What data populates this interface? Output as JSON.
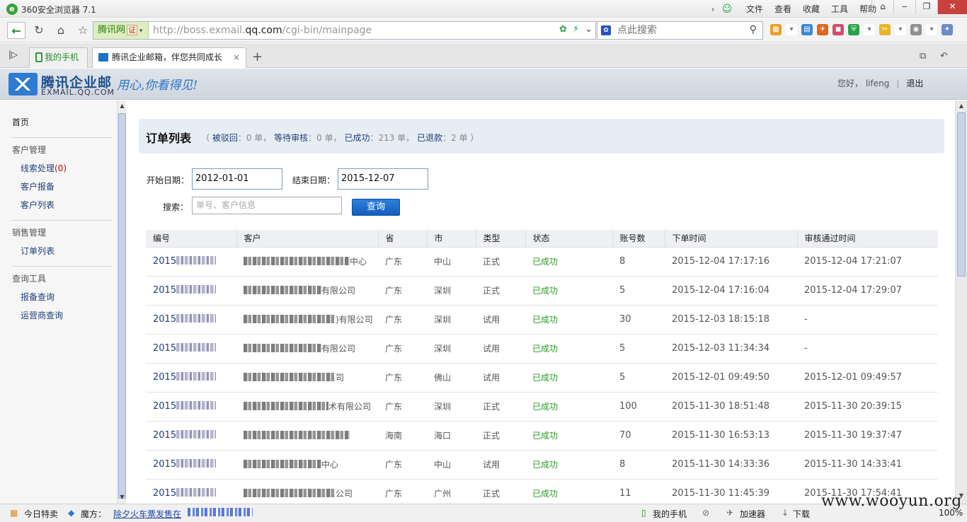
{
  "browser": {
    "title": "360安全浏览器 7.1",
    "menus": [
      "文件",
      "查看",
      "收藏",
      "工具",
      "帮助"
    ],
    "cert_label": "腾讯网",
    "cert_badge": "证",
    "url_prefix": "http://boss.exmail.",
    "url_domain": "qq.com",
    "url_suffix": "/cgi-bin/mainpage",
    "search_placeholder": "点此搜索",
    "tabs": [
      {
        "label": "我的手机"
      },
      {
        "label": "腾讯企业邮箱，伴您共同成长"
      }
    ]
  },
  "app": {
    "name": "腾讯企业邮",
    "domain": "EXMAIL.QQ.COM",
    "slogan": "用心,你看得见!",
    "greeting": "您好， lifeng",
    "logout": "退出"
  },
  "sidebar": {
    "home": "首页",
    "groups": [
      {
        "title": "客户管理",
        "items": [
          {
            "label": "线索处理",
            "count": "(0)"
          },
          {
            "label": "客户报备"
          },
          {
            "label": "客户列表"
          }
        ]
      },
      {
        "title": "销售管理",
        "items": [
          {
            "label": "订单列表"
          }
        ]
      },
      {
        "title": "查询工具",
        "items": [
          {
            "label": "报备查询"
          },
          {
            "label": "运营商查询"
          }
        ]
      }
    ]
  },
  "summary": {
    "title": "订单列表",
    "open": "（",
    "rejected_label": "被驳回",
    "rejected_value": "：0 单，",
    "pending_label": "等待审核",
    "pending_value": "：0 单，",
    "success_label": "已成功",
    "success_value": "：213 单，",
    "refund_label": "已退款",
    "refund_value": "：2 单 ）"
  },
  "filters": {
    "start_label": "开始日期：",
    "start_value": "2012-01-01",
    "end_label": "结束日期：",
    "end_value": "2015-12-07",
    "search_label": "搜索：",
    "search_placeholder": "单号、客户信息",
    "query_button": "查询"
  },
  "table": {
    "headers": [
      "编号",
      "客户",
      "省",
      "市",
      "类型",
      "状态",
      "账号数",
      "下单时间",
      "审核通过时间"
    ],
    "rows": [
      {
        "id": "2015",
        "client_tail": "中心",
        "province": "广东",
        "city": "中山",
        "type": "正式",
        "status": "已成功",
        "accounts": "8",
        "ordered": "2015-12-04 17:17:16",
        "approved": "2015-12-04 17:21:07"
      },
      {
        "id": "2015",
        "client_tail": "有限公司",
        "province": "广东",
        "city": "深圳",
        "type": "正式",
        "status": "已成功",
        "accounts": "5",
        "ordered": "2015-12-04 17:16:04",
        "approved": "2015-12-04 17:29:07"
      },
      {
        "id": "2015",
        "client_tail": ")有限公司",
        "province": "广东",
        "city": "深圳",
        "type": "试用",
        "status": "已成功",
        "accounts": "30",
        "ordered": "2015-12-03 18:15:18",
        "approved": "-"
      },
      {
        "id": "2015",
        "client_tail": "有限公司",
        "province": "广东",
        "city": "深圳",
        "type": "试用",
        "status": "已成功",
        "accounts": "5",
        "ordered": "2015-12-03 11:34:34",
        "approved": "-"
      },
      {
        "id": "2015",
        "client_tail": "司",
        "province": "广东",
        "city": "佛山",
        "type": "试用",
        "status": "已成功",
        "accounts": "5",
        "ordered": "2015-12-01 09:49:50",
        "approved": "2015-12-01 09:49:57"
      },
      {
        "id": "2015",
        "client_tail": "术有限公司",
        "province": "广东",
        "city": "深圳",
        "type": "正式",
        "status": "已成功",
        "accounts": "100",
        "ordered": "2015-11-30 18:51:48",
        "approved": "2015-11-30 20:39:15"
      },
      {
        "id": "2015",
        "client_tail": "",
        "province": "海南",
        "city": "海口",
        "type": "正式",
        "status": "已成功",
        "accounts": "70",
        "ordered": "2015-11-30 16:53:13",
        "approved": "2015-11-30 19:37:47"
      },
      {
        "id": "2015",
        "client_tail": "中心",
        "province": "广东",
        "city": "中山",
        "type": "试用",
        "status": "已成功",
        "accounts": "8",
        "ordered": "2015-11-30 14:33:36",
        "approved": "2015-11-30 14:33:41"
      },
      {
        "id": "2015",
        "client_tail": "公司",
        "province": "广东",
        "city": "广州",
        "type": "正式",
        "status": "已成功",
        "accounts": "11",
        "ordered": "2015-11-30 11:45:39",
        "approved": "2015-11-30 17:54:41"
      }
    ]
  },
  "statusbar": {
    "deals": "今日特卖",
    "magic": "魔方：",
    "news_link": "除夕火车票发售在",
    "my_phone": "我的手机",
    "accelerator": "加速器",
    "download": "下载",
    "zoom": "100%"
  },
  "watermark": "www.wooyun.org"
}
